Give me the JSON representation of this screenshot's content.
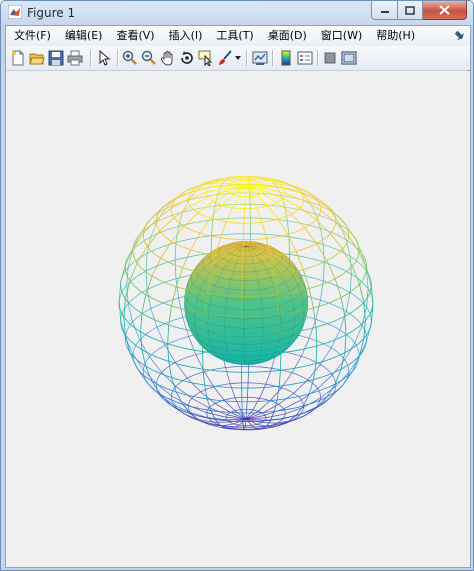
{
  "window": {
    "title": "Figure 1"
  },
  "menu": [
    {
      "id": "file",
      "label": "文件(F)"
    },
    {
      "id": "edit",
      "label": "编辑(E)"
    },
    {
      "id": "view",
      "label": "查看(V)"
    },
    {
      "id": "insert",
      "label": "插入(I)"
    },
    {
      "id": "tools",
      "label": "工具(T)"
    },
    {
      "id": "desktop",
      "label": "桌面(D)"
    },
    {
      "id": "window",
      "label": "窗口(W)"
    },
    {
      "id": "help",
      "label": "帮助(H)"
    }
  ],
  "toolbar_icons": [
    "new-figure-icon",
    "open-file-icon",
    "save-icon",
    "print-icon",
    "edit-plot-arrow-icon",
    "zoom-in-icon",
    "zoom-out-icon",
    "pan-hand-icon",
    "rotate-3d-icon",
    "data-cursor-icon",
    "brush-icon",
    "brush-dropdown-icon",
    "link-plot-icon",
    "colorbar-icon",
    "legend-icon",
    "hide-plot-tools-icon",
    "show-plot-tools-icon"
  ],
  "plot": {
    "outer_sphere": {
      "style": "mesh",
      "colormap": "parula"
    },
    "inner_sphere": {
      "style": "surface",
      "colormap": "parula"
    },
    "colors": {
      "low": "#3e26a8",
      "mid": "#14b5a8",
      "high": "#f9fb15"
    }
  }
}
